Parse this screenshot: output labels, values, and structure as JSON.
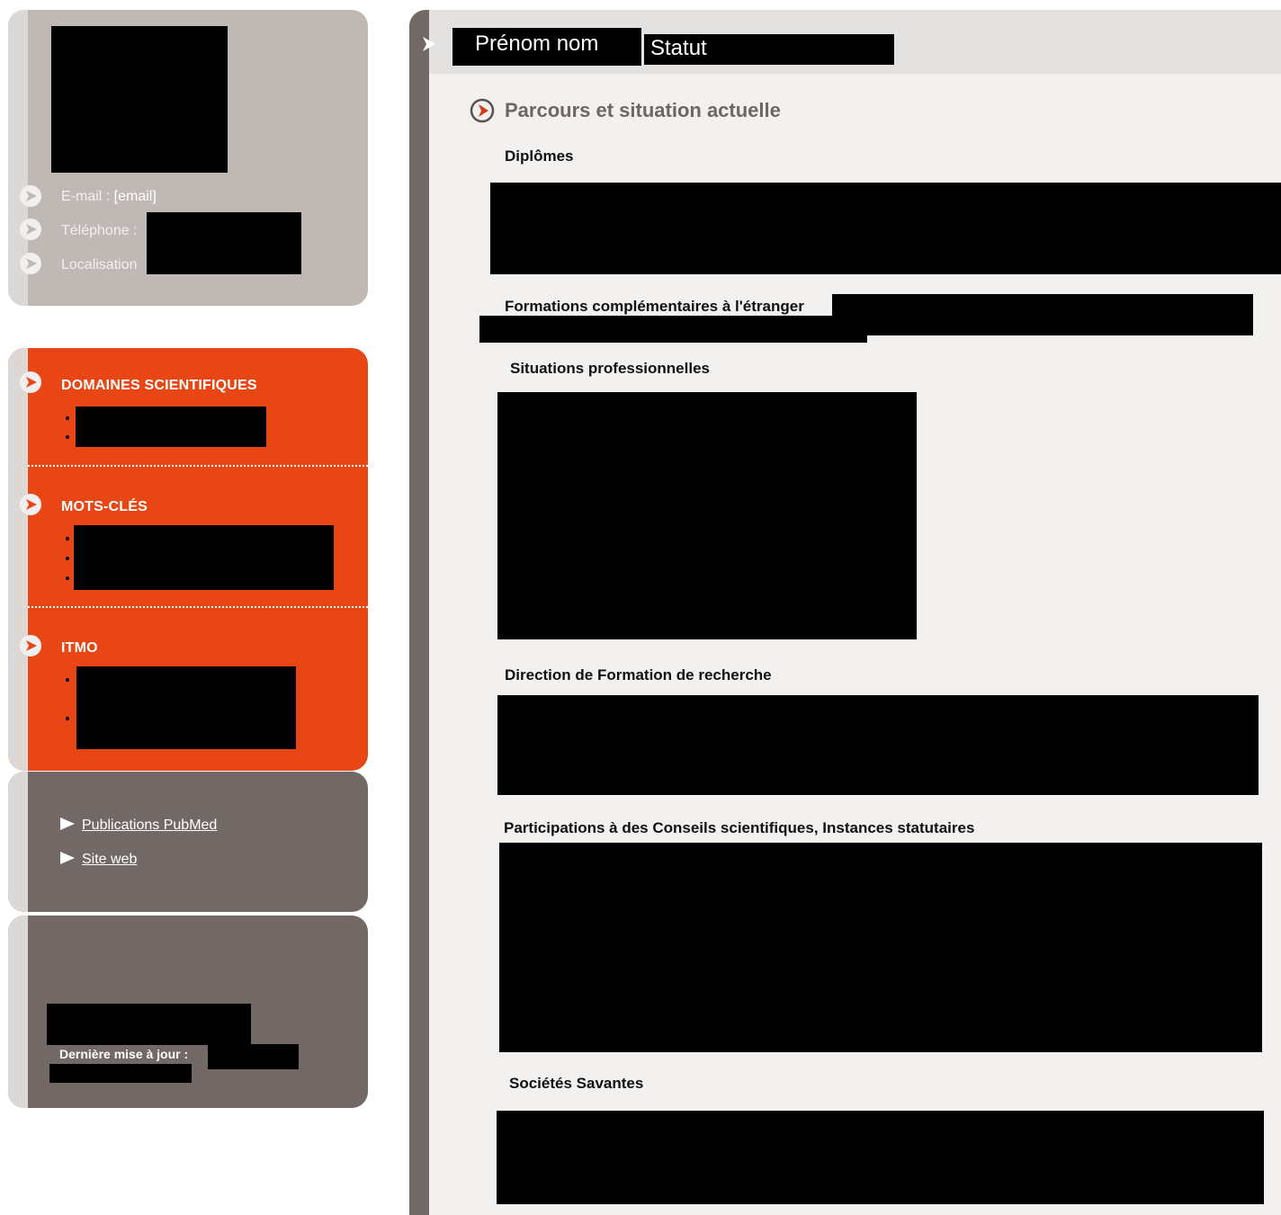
{
  "sidebar": {
    "profile": {
      "email_label": "E-mail : ",
      "email_value": "[email]",
      "phone_label": "Téléphone : ",
      "location_label": "Localisation"
    },
    "categories": [
      {
        "title": "DOMAINES SCIENTIFIQUES"
      },
      {
        "title": "MOTS-CLÉS"
      },
      {
        "title": "ITMO"
      }
    ],
    "links": [
      {
        "label": "Publications PubMed"
      },
      {
        "label": "Site web"
      }
    ],
    "update": {
      "label": "Dernière mise à jour :"
    }
  },
  "header": {
    "name": "Prénom nom",
    "status": "Statut"
  },
  "main": {
    "section_title": "Parcours et situation actuelle",
    "subsections": [
      {
        "title": "Diplômes"
      },
      {
        "title": "Formations complémentaires à l'étranger"
      },
      {
        "title": "Situations professionnelles"
      },
      {
        "title": "Direction de Formation de recherche"
      },
      {
        "title": "Participations à des Conseils scientifiques, Instances statutaires"
      },
      {
        "title": "Sociétés Savantes"
      }
    ]
  },
  "colors": {
    "accent_orange": "#e84614",
    "sidebar_gray": "#bfb8b4",
    "dark_brown": "#726966",
    "panel_bg": "#f3f1ef"
  }
}
